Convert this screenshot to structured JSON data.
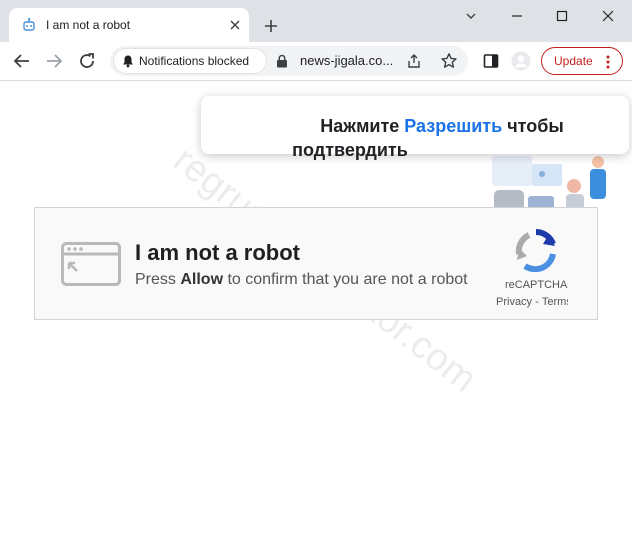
{
  "browser": {
    "tab_title": "I am not a robot",
    "notification_chip": "Notifications blocked",
    "url": "news-jigala.co...",
    "update_label": "Update"
  },
  "popup": {
    "prefix": "Нажмите ",
    "allow_word": "Разрешить",
    "suffix": " чтобы",
    "line2": "подтвердить"
  },
  "captcha": {
    "title": "I am not a robot",
    "sub_prefix": "Press ",
    "sub_bold": "Allow",
    "sub_suffix": " to confirm that you are not a robot",
    "recaptcha_label": "reCAPTCHA",
    "privacy": "Privacy",
    "sep": " - ",
    "terms": "Terms"
  },
  "watermark": "regrunreanimator.com",
  "colors": {
    "accent_blue": "#1a73e8",
    "update_red": "#c5221f",
    "titlebar": "#dee1e6"
  },
  "icons": {
    "favicon": "robot-head-icon",
    "tab_close": "close-icon",
    "new_tab": "plus-icon",
    "back": "arrow-left-icon",
    "forward": "arrow-right-icon",
    "reload": "reload-icon",
    "bell": "bell-icon",
    "lock": "lock-icon",
    "share": "share-icon",
    "star": "star-icon",
    "side_panel": "side-panel-icon",
    "profile": "profile-avatar-icon",
    "menu": "kebab-menu-icon",
    "minimize": "minimize-icon",
    "maximize": "maximize-icon",
    "close": "window-close-icon",
    "captcha": "browser-window-icon",
    "recaptcha": "recaptcha-logo-icon"
  }
}
